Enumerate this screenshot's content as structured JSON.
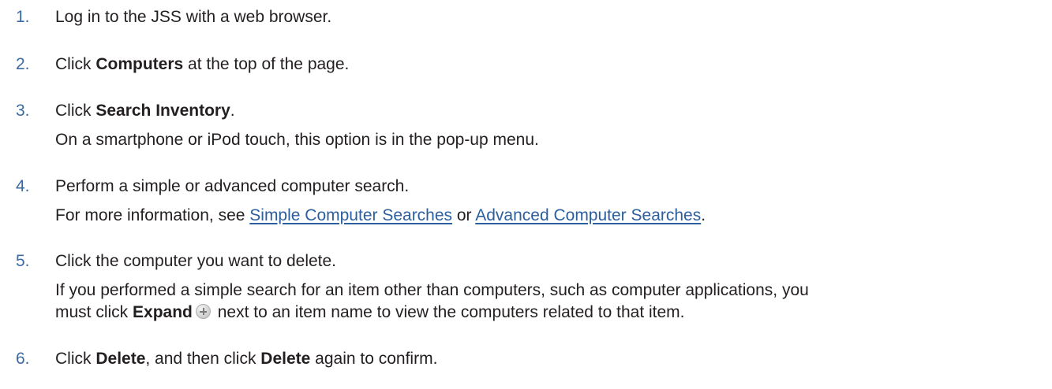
{
  "steps": [
    {
      "number": "1.",
      "text": "Log in to the JSS with a web browser."
    },
    {
      "number": "2.",
      "pre": "Click ",
      "bold": "Computers",
      "post": " at the top of the page."
    },
    {
      "number": "3.",
      "pre": "Click ",
      "bold": "Search Inventory",
      "post": ".",
      "note": "On a smartphone or iPod touch, this option is in the pop-up menu."
    },
    {
      "number": "4.",
      "text": "Perform a simple or advanced computer search.",
      "note_pre": "For more information, see ",
      "link1": "Simple Computer Searches",
      "note_mid": " or ",
      "link2": "Advanced Computer Searches",
      "note_post": "."
    },
    {
      "number": "5.",
      "text": "Click the computer you want to delete.",
      "note_line1": "If you performed a simple search for an item other than computers, such as computer applications, you",
      "note_line2_pre": "must click ",
      "note_line2_bold": "Expand",
      "note_line2_post": " next to an item name to view the computers related to that item."
    },
    {
      "number": "6.",
      "pre": "Click ",
      "bold1": "Delete",
      "mid": ", and then click ",
      "bold2": "Delete",
      "post": " again to confirm."
    }
  ],
  "colors": {
    "number": "#3b6aa3",
    "link": "#2c5f9e",
    "text": "#231f20"
  },
  "icons": {
    "expand": "plus-circle-icon"
  }
}
